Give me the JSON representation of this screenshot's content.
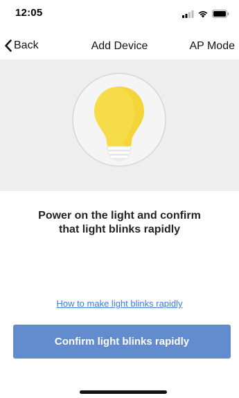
{
  "status_bar": {
    "time": "12:05",
    "icons": [
      "signal-icon",
      "wifi-icon",
      "battery-icon"
    ]
  },
  "nav": {
    "back_label": "Back",
    "title": "Add Device",
    "mode_label": "AP Mode"
  },
  "hero": {
    "icon": "lightbulb-icon"
  },
  "instruction": {
    "line1": "Power on the light and confirm",
    "line2": "that light blinks  rapidly"
  },
  "help_link": "How to make light blinks rapidly",
  "confirm_button": "Confirm light blinks rapidly",
  "colors": {
    "accent": "#628ccd",
    "link": "#3d7bd6",
    "hero_background": "#eeeeee",
    "bulb_yellow": "#f7dc4a"
  }
}
